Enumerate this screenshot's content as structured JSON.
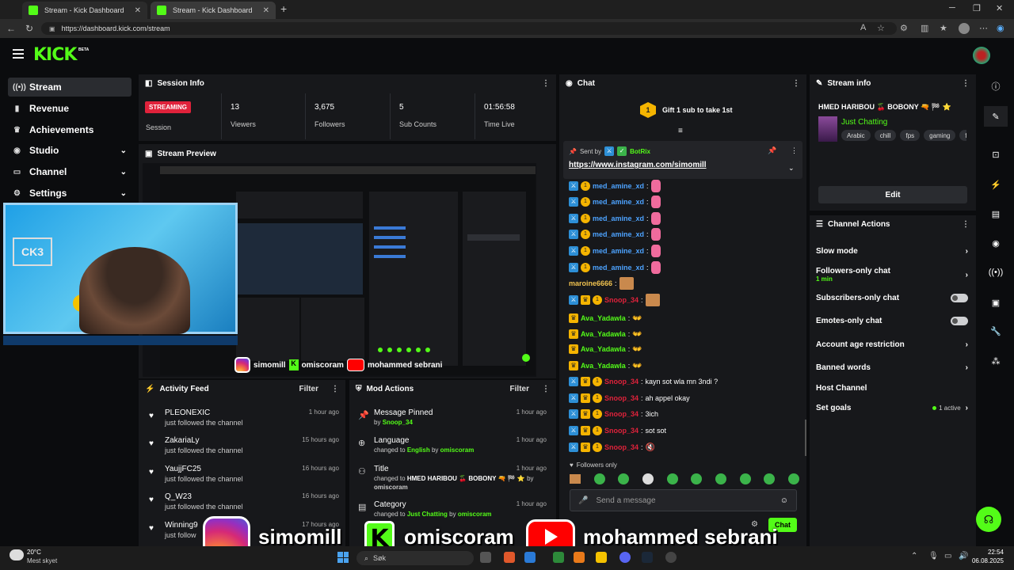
{
  "browser": {
    "tabs": [
      {
        "label": "Stream - Kick Dashboard"
      },
      {
        "label": "Stream - Kick Dashboard"
      }
    ],
    "url": "https://dashboard.kick.com/stream"
  },
  "app": {
    "logo": "KICK",
    "beta": "BETA"
  },
  "sidebar": {
    "items": [
      {
        "label": "Stream",
        "icon": "broadcast-icon"
      },
      {
        "label": "Revenue",
        "icon": "revenue-icon"
      },
      {
        "label": "Achievements",
        "icon": "trophy-icon"
      },
      {
        "label": "Studio",
        "icon": "studio-icon"
      },
      {
        "label": "Channel",
        "icon": "channel-icon"
      },
      {
        "label": "Settings",
        "icon": "gear-icon"
      }
    ]
  },
  "session_info": {
    "title": "Session Info",
    "live_badge": "STREAMING",
    "session_label": "Session",
    "stats": [
      {
        "value": "13",
        "label": "Viewers"
      },
      {
        "value": "3,675",
        "label": "Followers"
      },
      {
        "value": "5",
        "label": "Sub Counts"
      },
      {
        "value": "01:56:58",
        "label": "Time Live"
      }
    ]
  },
  "stream_preview": {
    "title": "Stream Preview"
  },
  "activity_feed": {
    "title": "Activity Feed",
    "filter": "Filter",
    "items": [
      {
        "name": "PLEONEXIC",
        "action": "just followed the channel",
        "time": "1 hour ago"
      },
      {
        "name": "ZakariaLy",
        "action": "just followed the channel",
        "time": "15 hours ago"
      },
      {
        "name": "YaujjFC25",
        "action": "just followed the channel",
        "time": "16 hours ago"
      },
      {
        "name": "Q_W23",
        "action": "just followed the channel",
        "time": "16 hours ago"
      },
      {
        "name": "Winning9",
        "action": "just follow",
        "time": "17 hours ago"
      }
    ]
  },
  "mod_actions": {
    "title": "Mod Actions",
    "filter": "Filter",
    "items": [
      {
        "title": "Message Pinned",
        "pre": "by",
        "value": "Snoop_34",
        "mid": "",
        "by": "",
        "time": "1 hour ago"
      },
      {
        "title": "Language",
        "pre": "changed to",
        "value": "English",
        "mid": "by",
        "by": "omiscoram",
        "time": "1 hour ago"
      },
      {
        "title": "Title",
        "pre": "changed to",
        "value": "HMED HARIBOU 🍒 BOBONY 🔫 🏁 ⭐",
        "mid": "by",
        "by": "omiscoram",
        "time": "1 hour ago"
      },
      {
        "title": "Category",
        "pre": "changed to",
        "value": "Just Chatting",
        "mid": "by",
        "by": "omiscoram",
        "time": "1 hour ago"
      }
    ]
  },
  "chat": {
    "title": "Chat",
    "gift_cta": "Gift 1 sub to take 1st",
    "gift_rank": "1",
    "pinned": {
      "sent_by_label": "Sent by",
      "sender": "BotRix",
      "link": "https://www.instagram.com/simomill"
    },
    "messages": [
      {
        "user": "med_amine_xd",
        "text": "",
        "color": "blue"
      },
      {
        "user": "med_amine_xd",
        "text": "",
        "color": "blue"
      },
      {
        "user": "med_amine_xd",
        "text": "",
        "color": "blue"
      },
      {
        "user": "med_amine_xd",
        "text": "",
        "color": "blue"
      },
      {
        "user": "med_amine_xd",
        "text": "",
        "color": "blue"
      },
      {
        "user": "med_amine_xd",
        "text": "",
        "color": "blue"
      },
      {
        "user": "maroine6666",
        "text": "",
        "color": "gold"
      },
      {
        "user": "Snoop_34",
        "text": "",
        "color": "red"
      },
      {
        "user": "Ava_Yadawla",
        "text": "",
        "color": "green"
      },
      {
        "user": "Ava_Yadawla",
        "text": "",
        "color": "green"
      },
      {
        "user": "Ava_Yadawla",
        "text": "",
        "color": "green"
      },
      {
        "user": "Ava_Yadawla",
        "text": "",
        "color": "green"
      },
      {
        "user": "Snoop_34",
        "text": "kayn sot wla mn 3ndi ?",
        "color": "red"
      },
      {
        "user": "Snoop_34",
        "text": "ah appel okay",
        "color": "red"
      },
      {
        "user": "Snoop_34",
        "text": "3ich",
        "color": "red"
      },
      {
        "user": "Snoop_34",
        "text": "sot sot",
        "color": "red"
      },
      {
        "user": "Snoop_34",
        "text": "",
        "color": "red"
      }
    ],
    "followers_only": "Followers only",
    "input_placeholder": "Send a message",
    "send_label": "Chat"
  },
  "stream_info": {
    "title": "Stream info",
    "stream_title": "HMED HARIBOU 🍒 BOBONY 🔫 🏁 ⭐",
    "category": "Just Chatting",
    "tags": [
      "Arabic",
      "chill",
      "fps",
      "gaming",
      "fu"
    ],
    "edit": "Edit"
  },
  "channel_actions": {
    "title": "Channel Actions",
    "items": [
      {
        "label": "Slow mode",
        "sub": "",
        "control": "chevron"
      },
      {
        "label": "Followers-only chat",
        "sub": "1 min",
        "control": "chevron"
      },
      {
        "label": "Subscribers-only chat",
        "sub": "",
        "control": "toggle"
      },
      {
        "label": "Emotes-only chat",
        "sub": "",
        "control": "toggle"
      },
      {
        "label": "Account age restriction",
        "sub": "",
        "control": "chevron"
      },
      {
        "label": "Banned words",
        "sub": "",
        "control": "chevron"
      },
      {
        "label": "Host Channel",
        "sub": "",
        "control": "none"
      },
      {
        "label": "Set goals",
        "sub": "",
        "control": "chevron"
      }
    ],
    "goals_status": "1 active"
  },
  "overlay": {
    "instagram": "simomill",
    "kick": "omiscoram",
    "youtube": "mohammed sebrani"
  },
  "taskbar": {
    "temp": "20°C",
    "weather": "Mest skyet",
    "search": "Søk",
    "time": "22:54",
    "date": "06.08.2025"
  },
  "colors": {
    "accent": "#53fc18",
    "live": "#e0223b",
    "mod_blue": "#2d8fd6",
    "sub_gold": "#f5b400"
  }
}
